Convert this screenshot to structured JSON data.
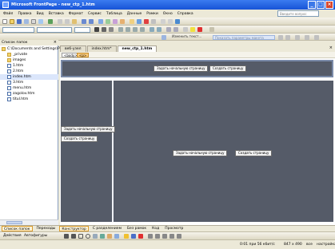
{
  "window": {
    "title": "Microsoft FrontPage - new_ctp_1.htm",
    "controls": [
      "_",
      "□",
      "×"
    ]
  },
  "menu": {
    "items": [
      "Файл",
      "Правка",
      "Вид",
      "Вставка",
      "Формат",
      "Сервис",
      "Таблица",
      "Данные",
      "Рамки",
      "Окно",
      "Справка"
    ],
    "ask_placeholder": "Введите вопрос"
  },
  "toolbar3": {
    "page_desc": "Изменить текст...",
    "link_info": "Показать параметры макета"
  },
  "folder_pane": {
    "title": "Список папок",
    "items": [
      {
        "label": "C:\\Documents and Settings\\Ро",
        "type": "folder",
        "indent": 0
      },
      {
        "label": "_private",
        "type": "folder",
        "indent": 1
      },
      {
        "label": "images",
        "type": "folder",
        "indent": 1
      },
      {
        "label": "1.htm",
        "type": "file",
        "indent": 1
      },
      {
        "label": "2.htm",
        "type": "file",
        "indent": 1
      },
      {
        "label": "index.htm",
        "type": "file",
        "indent": 1,
        "selected": true
      },
      {
        "label": "3.htm",
        "type": "file",
        "indent": 1
      },
      {
        "label": "menu.htm",
        "type": "file",
        "indent": 1
      },
      {
        "label": "zagolov.htm",
        "type": "file",
        "indent": 1
      },
      {
        "label": "titul.htm",
        "type": "file",
        "indent": 1
      }
    ]
  },
  "editor": {
    "tabs": [
      {
        "label": "веб-узел",
        "active": false
      },
      {
        "label": "index.htm*",
        "active": false
      },
      {
        "label": "new_ctp_1.htm",
        "active": true
      }
    ],
    "tags": [
      "<body>",
      "<p>"
    ],
    "buttons": {
      "set_start": "Задать начальную страницу",
      "create_page": "Создать страницу"
    }
  },
  "view_tabs": [
    {
      "label": "Список папок",
      "active": true
    },
    {
      "label": "Переходы",
      "active": false
    },
    {
      "label": "Конструктор",
      "active": true
    },
    {
      "label": "С разделением",
      "active": false
    },
    {
      "label": "Без рамок",
      "active": false
    },
    {
      "label": "Код",
      "active": false
    },
    {
      "label": "Просмотр",
      "active": false
    }
  ],
  "drawbar": {
    "actions_label": "Действия",
    "autoshapes_label": "Автофигуры"
  },
  "status": {
    "speed": "0:01 при 56 кбит/с",
    "size": "847 x 490",
    "mode": "все",
    "custom": "настройка"
  }
}
